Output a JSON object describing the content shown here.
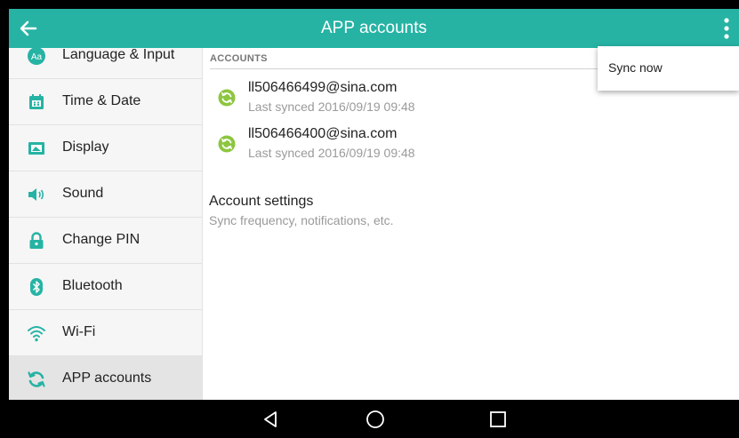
{
  "appbar": {
    "title": "APP accounts",
    "back_icon": "arrow-back-icon",
    "overflow_icon": "more-vert-icon",
    "color": "#26b3a4"
  },
  "sidebar": {
    "items": [
      {
        "label": "Language & Input",
        "icon": "language-icon"
      },
      {
        "label": "Time & Date",
        "icon": "calendar-icon"
      },
      {
        "label": "Display",
        "icon": "display-icon"
      },
      {
        "label": "Sound",
        "icon": "speaker-icon"
      },
      {
        "label": "Change PIN",
        "icon": "lock-icon"
      },
      {
        "label": "Bluetooth",
        "icon": "bluetooth-icon"
      },
      {
        "label": "Wi-Fi",
        "icon": "wifi-icon"
      },
      {
        "label": "APP accounts",
        "icon": "sync-icon",
        "selected": true
      }
    ]
  },
  "main": {
    "section_header": "ACCOUNTS",
    "accounts": [
      {
        "email": "ll506466499@sina.com",
        "last_synced": "Last synced 2016/09/19 09:48"
      },
      {
        "email": "ll506466400@sina.com",
        "last_synced": "Last synced 2016/09/19 09:48"
      }
    ],
    "account_settings": {
      "title": "Account settings",
      "subtitle": "Sync frequency, notifications, etc."
    }
  },
  "menu": {
    "items": [
      {
        "label": "Sync now"
      }
    ]
  },
  "navbar": {
    "buttons": [
      "back-triangle-icon",
      "home-circle-icon",
      "recents-square-icon"
    ]
  },
  "colors": {
    "accent": "#26b3a4",
    "icon_green": "#8dc63f"
  }
}
